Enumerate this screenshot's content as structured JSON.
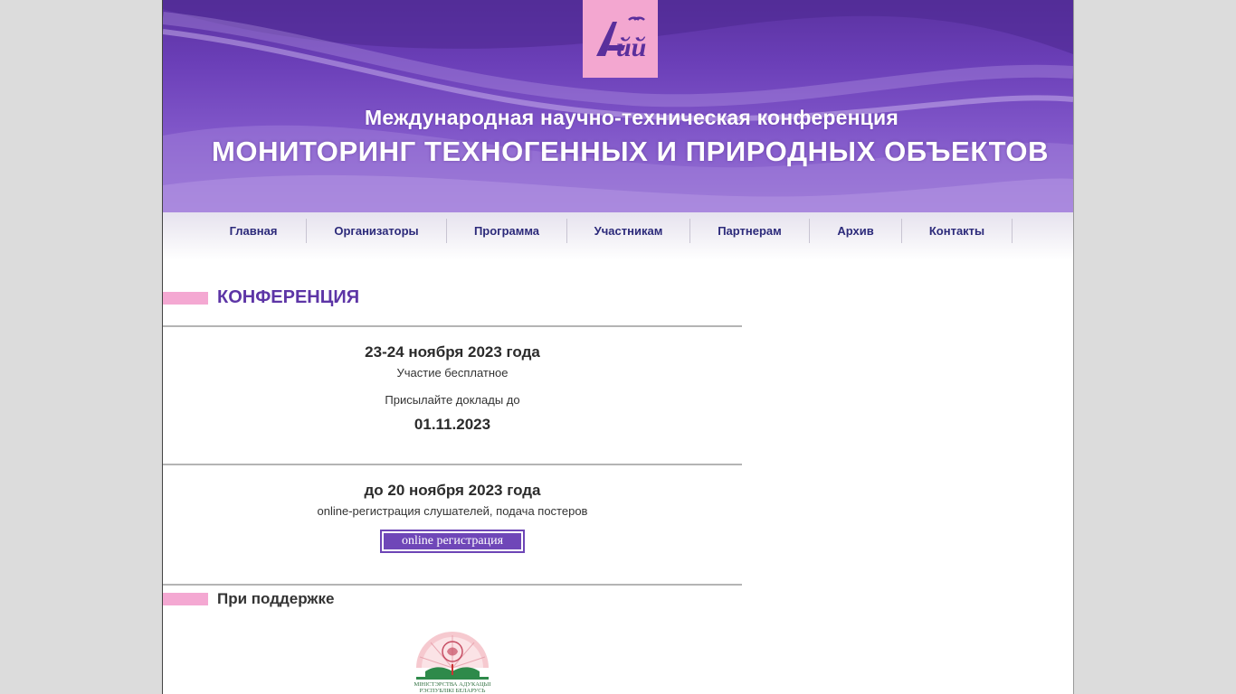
{
  "banner": {
    "subtitle": "Международная научно-техническая конференция",
    "title": "МОНИТОРИНГ ТЕХНОГЕННЫХ И ПРИРОДНЫХ ОБЪЕКТОВ",
    "logo_text": "Лйй"
  },
  "nav": {
    "items": [
      {
        "label": "Главная"
      },
      {
        "label": "Организаторы"
      },
      {
        "label": "Программа"
      },
      {
        "label": "Участникам"
      },
      {
        "label": "Партнерам"
      },
      {
        "label": "Архив"
      },
      {
        "label": "Контакты"
      }
    ]
  },
  "conference": {
    "heading": "КОНФЕРЕНЦИЯ",
    "block1": {
      "dates": "23-24 ноября 2023 года",
      "free": "Участие бесплатное",
      "send_papers": "Присылайте доклады до",
      "deadline": "01.11.2023"
    },
    "block2": {
      "date": "до 20 ноября 2023 года",
      "description": "online-регистрация слушателей, подача постеров",
      "button_label": "online регистрация"
    }
  },
  "support": {
    "heading": "При поддержке",
    "emblem_line1": "МІНІСТЭРСТВА АДУКАЦЫІ",
    "emblem_line2": "РЭСПУБЛІКІ БЕЛАРУСЬ"
  },
  "colors": {
    "accent_purple": "#6f47b8",
    "heading_purple": "#5d35a6",
    "pink": "#f4a8d2",
    "nav_text": "#2c2a7a"
  }
}
